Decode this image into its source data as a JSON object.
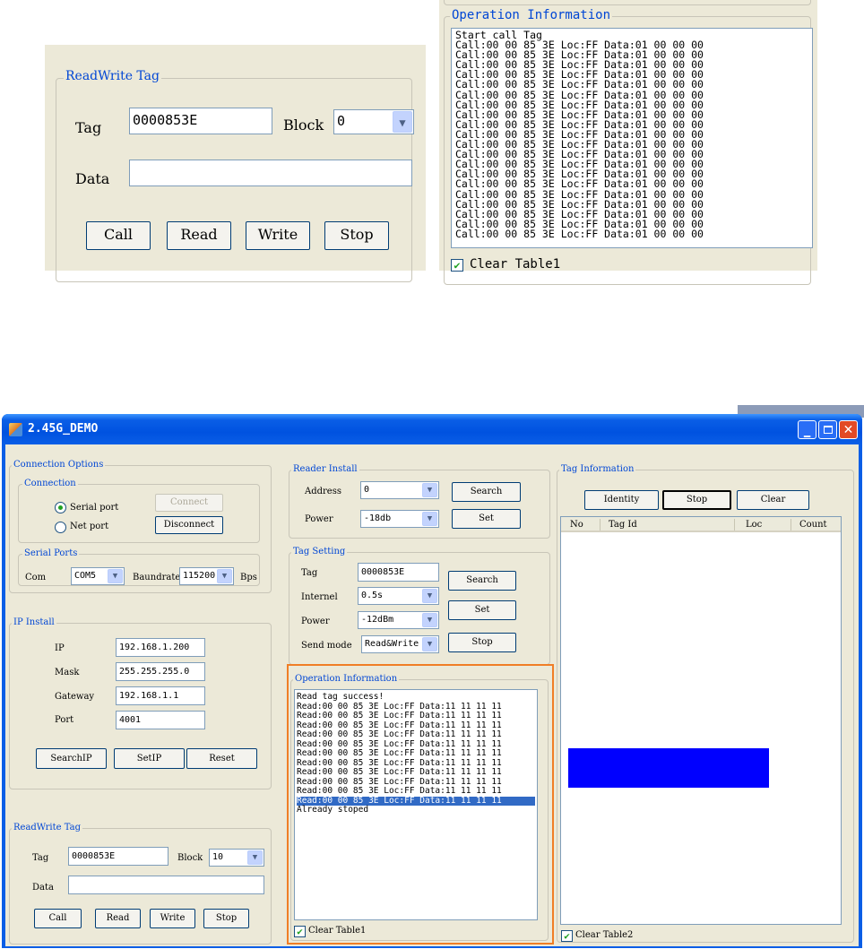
{
  "zoom1": {
    "group_title": "ReadWrite Tag",
    "tag_label": "Tag",
    "tag_value": "0000853E",
    "block_label": "Block",
    "block_value": "0",
    "data_label": "Data",
    "data_value": "",
    "buttons": [
      "Call",
      "Read",
      "Write",
      "Stop"
    ]
  },
  "zoom2": {
    "group_title": "Operation Information",
    "lines": [
      "Start call Tag",
      "Call:00 00 85 3E Loc:FF Data:01 00 00 00",
      "Call:00 00 85 3E Loc:FF Data:01 00 00 00",
      "Call:00 00 85 3E Loc:FF Data:01 00 00 00",
      "Call:00 00 85 3E Loc:FF Data:01 00 00 00",
      "Call:00 00 85 3E Loc:FF Data:01 00 00 00",
      "Call:00 00 85 3E Loc:FF Data:01 00 00 00",
      "Call:00 00 85 3E Loc:FF Data:01 00 00 00",
      "Call:00 00 85 3E Loc:FF Data:01 00 00 00",
      "Call:00 00 85 3E Loc:FF Data:01 00 00 00",
      "Call:00 00 85 3E Loc:FF Data:01 00 00 00",
      "Call:00 00 85 3E Loc:FF Data:01 00 00 00",
      "Call:00 00 85 3E Loc:FF Data:01 00 00 00",
      "Call:00 00 85 3E Loc:FF Data:01 00 00 00",
      "Call:00 00 85 3E Loc:FF Data:01 00 00 00",
      "Call:00 00 85 3E Loc:FF Data:01 00 00 00",
      "Call:00 00 85 3E Loc:FF Data:01 00 00 00",
      "Call:00 00 85 3E Loc:FF Data:01 00 00 00",
      "Call:00 00 85 3E Loc:FF Data:01 00 00 00",
      "Call:00 00 85 3E Loc:FF Data:01 00 00 00",
      "Call:00 00 85 3E Loc:FF Data:01 00 00 00"
    ],
    "clear_label": "Clear Table1",
    "clear_checked": true
  },
  "window": {
    "title": "2.45G_DEMO",
    "connection_options": {
      "title": "Connection Options",
      "connection": {
        "title": "Connection",
        "serial_label": "Serial port",
        "net_label": "Net port",
        "connect_label": "Connect",
        "disconnect_label": "Disconnect"
      },
      "serial_ports": {
        "title": "Serial Ports",
        "com_label": "Com",
        "com_value": "COM5",
        "baud_label": "Baundrate",
        "baud_value": "115200",
        "bps_label": "Bps"
      }
    },
    "ip_install": {
      "title": "IP Install",
      "ip_label": "IP",
      "ip_value": "192.168.1.200",
      "mask_label": "Mask",
      "mask_value": "255.255.255.0",
      "gateway_label": "Gateway",
      "gateway_value": "192.168.1.1",
      "port_label": "Port",
      "port_value": "4001",
      "search_ip": "SearchIP",
      "set_ip": "SetIP",
      "reset": "Reset"
    },
    "readwrite": {
      "title": "ReadWrite Tag",
      "tag_label": "Tag",
      "tag_value": "0000853E",
      "block_label": "Block",
      "block_value": "10",
      "data_label": "Data",
      "data_value": "",
      "buttons": [
        "Call",
        "Read",
        "Write",
        "Stop"
      ]
    },
    "reader_install": {
      "title": "Reader Install",
      "address_label": "Address",
      "address_value": "0",
      "power_label": "Power",
      "power_value": "-18db",
      "search": "Search",
      "set": "Set"
    },
    "tag_setting": {
      "title": "Tag Setting",
      "tag_label": "Tag",
      "tag_value": "0000853E",
      "internel_label": "Internel",
      "internel_value": "0.5s",
      "power_label": "Power",
      "power_value": "-12dBm",
      "send_label": "Send mode",
      "send_value": "Read&Write",
      "search": "Search",
      "set": "Set",
      "stop": "Stop"
    },
    "operation_info": {
      "title": "Operation Information",
      "lines": [
        "Read tag success!",
        "Read:00 00 85 3E Loc:FF Data:11 11 11 11",
        "Read:00 00 85 3E Loc:FF Data:11 11 11 11",
        "Read:00 00 85 3E Loc:FF Data:11 11 11 11",
        "Read:00 00 85 3E Loc:FF Data:11 11 11 11",
        "Read:00 00 85 3E Loc:FF Data:11 11 11 11",
        "Read:00 00 85 3E Loc:FF Data:11 11 11 11",
        "Read:00 00 85 3E Loc:FF Data:11 11 11 11",
        "Read:00 00 85 3E Loc:FF Data:11 11 11 11",
        "Read:00 00 85 3E Loc:FF Data:11 11 11 11",
        "Read:00 00 85 3E Loc:FF Data:11 11 11 11",
        "Read:00 00 85 3E Loc:FF Data:11 11 11 11",
        "Already stoped"
      ],
      "selected_index": 11,
      "clear_label": "Clear Table1",
      "clear_checked": true
    },
    "tag_info": {
      "title": "Tag Information",
      "identity": "Identity",
      "stop": "Stop",
      "clear": "Clear",
      "columns": [
        "No",
        "Tag Id",
        "Loc",
        "Count"
      ],
      "clear_label": "Clear Table2",
      "clear_checked": true
    }
  },
  "colors": {
    "xp_title_bar": "#0a5ee6",
    "panel_bg": "#ece9d8",
    "group_title": "#0046d5",
    "highlight_border": "#f07e26",
    "selection": "#316ac5",
    "blue_block": "#0000ff",
    "check_green": "#21a121"
  }
}
